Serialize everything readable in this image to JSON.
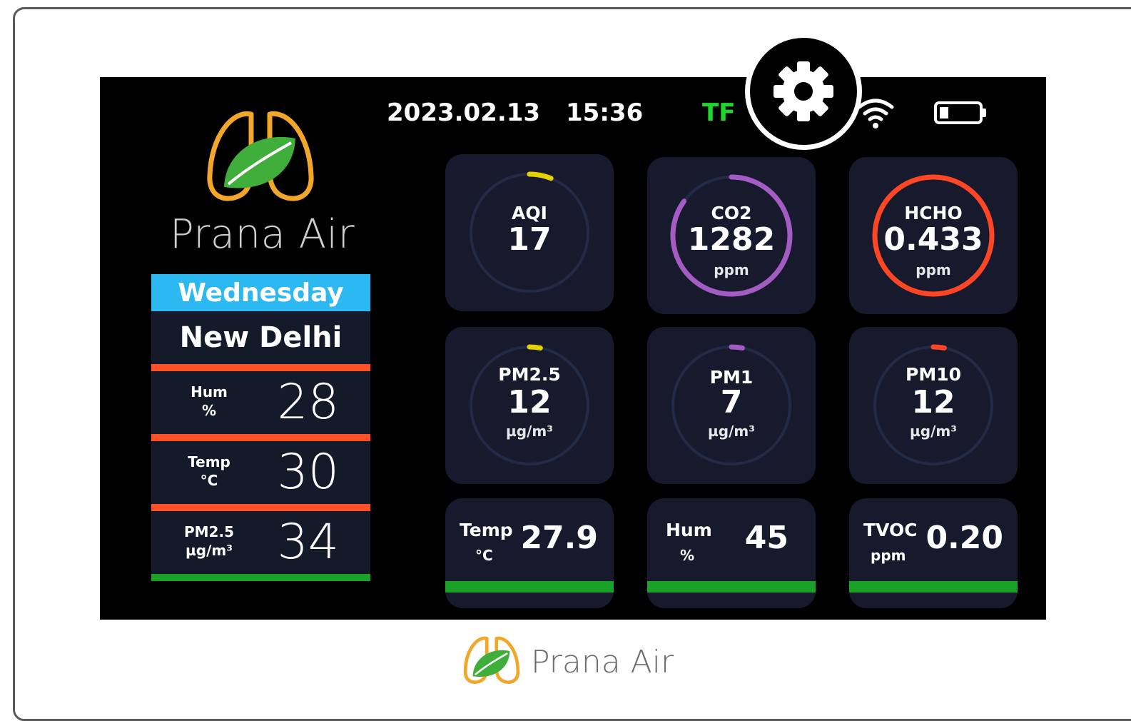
{
  "brand": {
    "name": "Prana Air",
    "footer_name": "Prana Air"
  },
  "status_bar": {
    "date": "2023.02.13",
    "time": "15:36",
    "mode": "TF",
    "wifi_icon": "wifi-icon",
    "battery_icon": "battery-icon",
    "settings_icon": "gear-icon"
  },
  "left_panel": {
    "day": "Wednesday",
    "city": "New Delhi",
    "rows": [
      {
        "label": "Hum",
        "unit": "%",
        "value": "28",
        "bar_color": "#ff5128"
      },
      {
        "label": "Temp",
        "unit": "°C",
        "value": "30",
        "bar_color": "#ff5128"
      },
      {
        "label": "PM2.5",
        "unit": "µg/m³",
        "value": "34",
        "bar_color": "#1aa128"
      }
    ]
  },
  "gauges": [
    {
      "label": "AQI",
      "value": "17",
      "unit": "",
      "color": "#e3d200",
      "level": 0.06
    },
    {
      "label": "CO2",
      "value": "1282",
      "unit": "ppm",
      "color": "#a45cc4",
      "level": 0.85
    },
    {
      "label": "HCHO",
      "value": "0.433",
      "unit": "ppm",
      "color": "#ff4624",
      "level": 1.0
    },
    {
      "label": "PM2.5",
      "value": "12",
      "unit": "µg/m³",
      "color": "#e3d200",
      "level": 0.03
    },
    {
      "label": "PM1",
      "value": "7",
      "unit": "µg/m³",
      "color": "#a45cc4",
      "level": 0.03
    },
    {
      "label": "PM10",
      "value": "12",
      "unit": "µg/m³",
      "color": "#ff4624",
      "level": 0.03
    }
  ],
  "minis": [
    {
      "label": "Temp",
      "unit": "°C",
      "value": "27.9"
    },
    {
      "label": "Hum",
      "unit": "%",
      "value": "45"
    },
    {
      "label": "TVOC",
      "unit": "ppm",
      "value": "0.20"
    }
  ],
  "colors": {
    "accent_blue": "#2cb8f0",
    "orange": "#ff5128",
    "green": "#1aa128",
    "panel": "#161a2c",
    "ring_track": "#232a45"
  }
}
